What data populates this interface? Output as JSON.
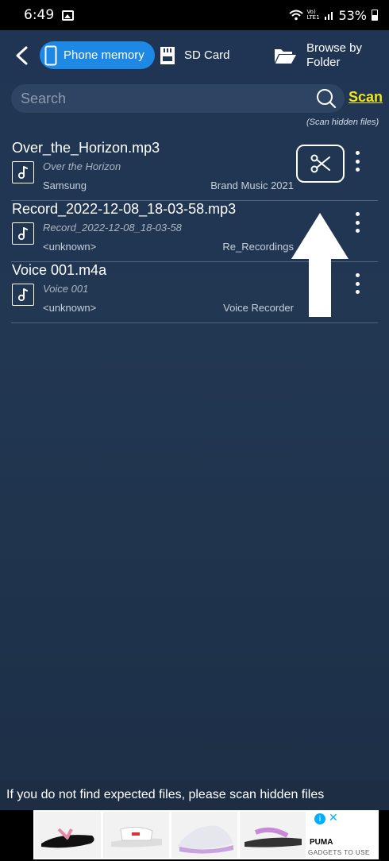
{
  "status_bar": {
    "time": "6:49",
    "network_label": "Vo) LTE1",
    "battery": "53%"
  },
  "tabs": {
    "phone_memory": "Phone memory",
    "sd_card": "SD Card",
    "browse_by_folder": "Browse by Folder"
  },
  "search": {
    "placeholder": "Search",
    "scan_label": "Scan",
    "scan_note": "(Scan hidden files)"
  },
  "files": [
    {
      "filename": "Over_the_Horizon.mp3",
      "title": "Over the Horizon",
      "artist": "Samsung",
      "album": "Brand Music 2021"
    },
    {
      "filename": "Record_2022-12-08_18-03-58.mp3",
      "title": "Record_2022-12-08_18-03-58",
      "artist": "<unknown>",
      "album": "Re_Recordings"
    },
    {
      "filename": "Voice 001.m4a",
      "title": "Voice 001",
      "artist": "<unknown>",
      "album": "Voice Recorder"
    }
  ],
  "footer_note": "If you do not find expected files, please scan hidden files",
  "ad": {
    "brand": "PUMA",
    "watermark": "GADGETS TO USE"
  },
  "colors": {
    "accent": "#1e88e5",
    "scan_link": "#f2e51a",
    "background": "#1f3553"
  }
}
